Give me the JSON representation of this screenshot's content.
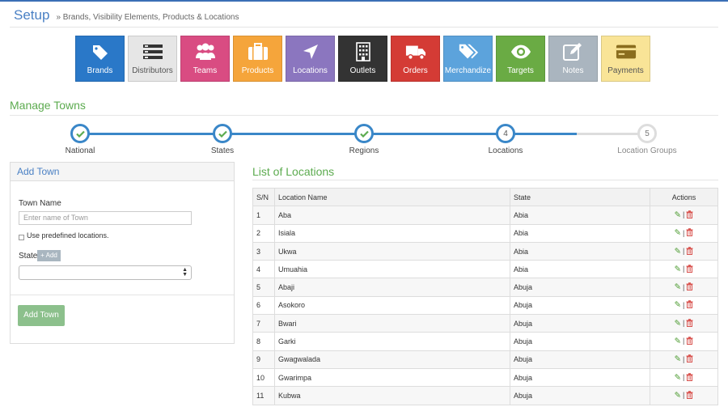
{
  "header": {
    "title": "Setup",
    "breadcrumb": "Brands, Visibility Elements, Products & Locations"
  },
  "tiles": [
    {
      "label": "Brands",
      "color": "#2a78c8",
      "icon": "tag-icon"
    },
    {
      "label": "Distributors",
      "color": "#e6e6e6",
      "icon": "list-icon"
    },
    {
      "label": "Teams",
      "color": "#d94c82",
      "icon": "users-icon"
    },
    {
      "label": "Products",
      "color": "#f5a53b",
      "icon": "briefcase-icon"
    },
    {
      "label": "Locations",
      "color": "#8b76bf",
      "icon": "location-arrow-icon"
    },
    {
      "label": "Outlets",
      "color": "#333333",
      "icon": "building-icon"
    },
    {
      "label": "Orders",
      "color": "#d43b35",
      "icon": "truck-icon"
    },
    {
      "label": "Merchandize",
      "color": "#5ca3dc",
      "icon": "tags-icon"
    },
    {
      "label": "Targets",
      "color": "#6aab44",
      "icon": "eye-icon"
    },
    {
      "label": "Notes",
      "color": "#aab5bf",
      "icon": "edit-icon"
    },
    {
      "label": "Payments",
      "color": "#f9e497",
      "icon": "credit-card-icon"
    }
  ],
  "section_title": "Manage Towns",
  "steps": [
    {
      "label": "National",
      "state": "done",
      "number": ""
    },
    {
      "label": "States",
      "state": "done",
      "number": ""
    },
    {
      "label": "Regions",
      "state": "done",
      "number": ""
    },
    {
      "label": "Locations",
      "state": "current",
      "number": "4"
    },
    {
      "label": "Location Groups",
      "state": "pending",
      "number": "5"
    }
  ],
  "form": {
    "title": "Add Town",
    "town_name_label": "Town Name",
    "town_name_placeholder": "Enter name of Town",
    "predefined_label": "Use predefined locations.",
    "state_label": "State",
    "add_label": "+ Add",
    "submit_label": "Add Town"
  },
  "list": {
    "title": "List of Locations",
    "columns": [
      "S/N",
      "Location Name",
      "State",
      "Actions"
    ],
    "rows": [
      {
        "sn": "1",
        "name": "Aba",
        "state": "Abia"
      },
      {
        "sn": "2",
        "name": "Isiala",
        "state": "Abia"
      },
      {
        "sn": "3",
        "name": "Ukwa",
        "state": "Abia"
      },
      {
        "sn": "4",
        "name": "Umuahia",
        "state": "Abia"
      },
      {
        "sn": "5",
        "name": "Abaji",
        "state": "Abuja"
      },
      {
        "sn": "6",
        "name": "Asokoro",
        "state": "Abuja"
      },
      {
        "sn": "7",
        "name": "Bwari",
        "state": "Abuja"
      },
      {
        "sn": "8",
        "name": "Garki",
        "state": "Abuja"
      },
      {
        "sn": "9",
        "name": "Gwagwalada",
        "state": "Abuja"
      },
      {
        "sn": "10",
        "name": "Gwarimpa",
        "state": "Abuja"
      },
      {
        "sn": "11",
        "name": "Kubwa",
        "state": "Abuja"
      }
    ]
  },
  "colors": {
    "accent": "#4a80c4",
    "green": "#5cab4f",
    "step_blue": "#3a87c8"
  }
}
